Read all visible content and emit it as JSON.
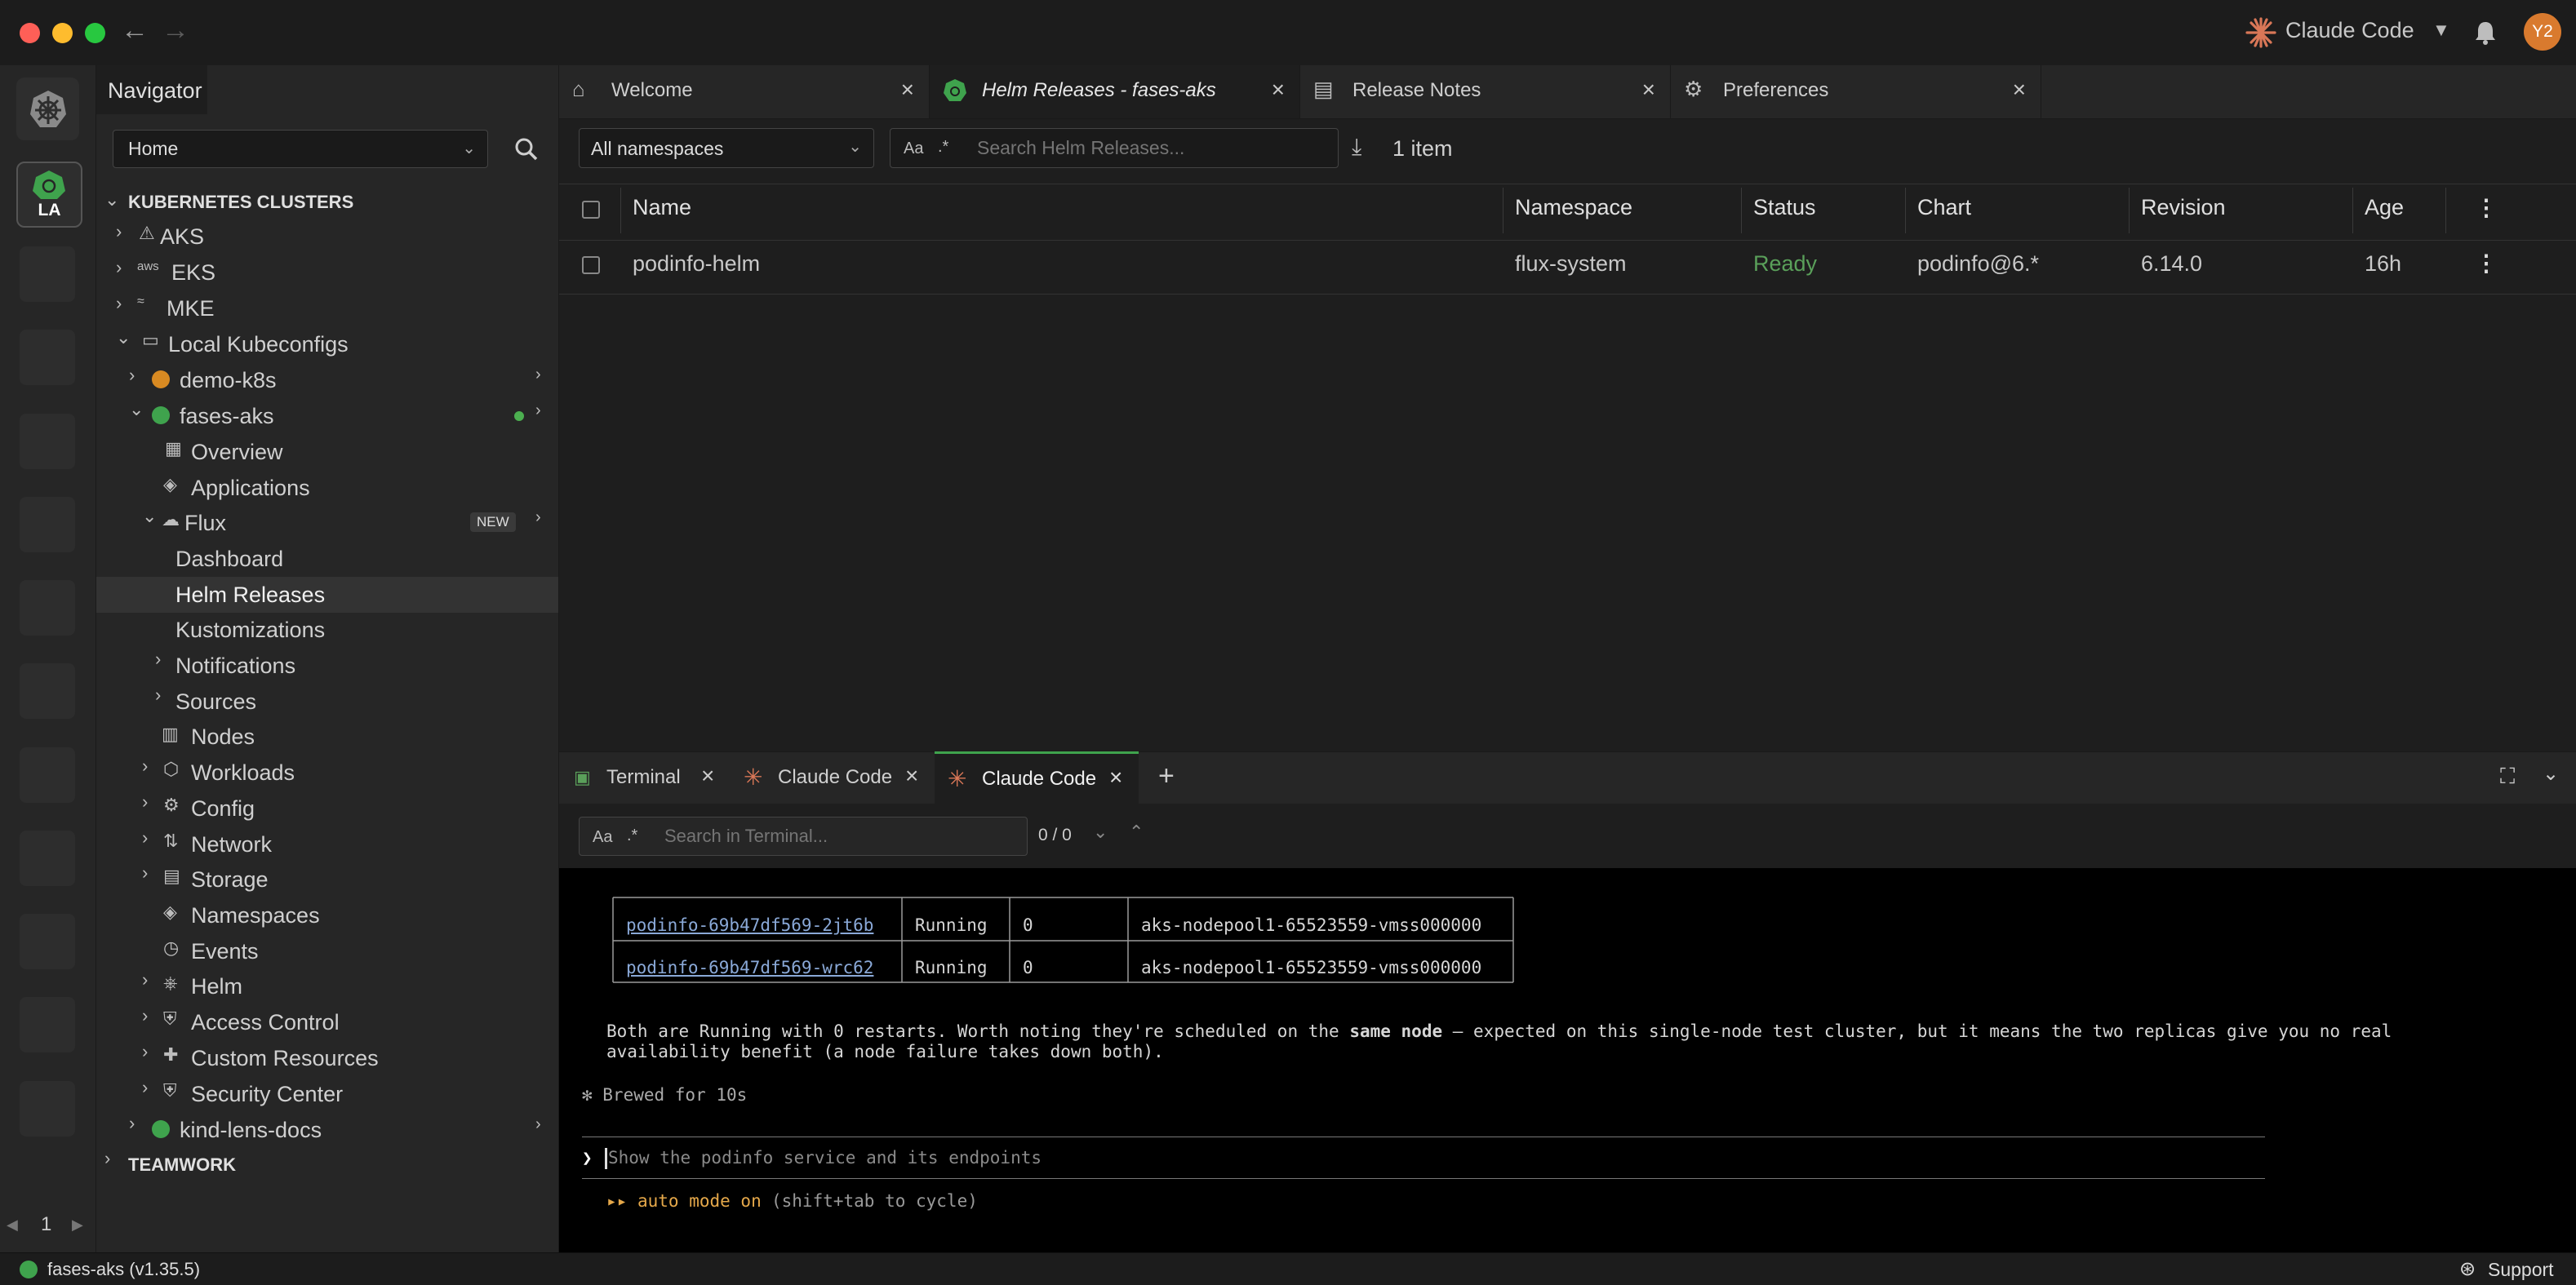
{
  "window": {
    "app_title": "Claude Code",
    "avatar_initials": "Y2"
  },
  "hotbar": {
    "cluster_badge": "LA"
  },
  "navigator": {
    "title": "Navigator",
    "workspace_select": "Home",
    "section_clusters": "KUBERNETES CLUSTERS",
    "providers": [
      "AKS",
      "EKS",
      "MKE"
    ],
    "eks_logo_text": "aws",
    "local_group": "Local Kubeconfigs",
    "clusters": {
      "demo": "demo-k8s",
      "fases": "fases-aks",
      "kind": "kind-lens-docs"
    },
    "items": {
      "overview": "Overview",
      "applications": "Applications",
      "flux": "Flux",
      "flux_badge": "NEW",
      "dashboard": "Dashboard",
      "helm_releases": "Helm Releases",
      "kustomizations": "Kustomizations",
      "notifications": "Notifications",
      "sources": "Sources",
      "nodes": "Nodes",
      "workloads": "Workloads",
      "config": "Config",
      "network": "Network",
      "storage": "Storage",
      "namespaces": "Namespaces",
      "events": "Events",
      "helm": "Helm",
      "access_control": "Access Control",
      "custom_resources": "Custom Resources",
      "security_center": "Security Center"
    },
    "section_teamwork": "TEAMWORK",
    "page_number": "1"
  },
  "tabs": [
    {
      "label": "Welcome"
    },
    {
      "label": "Helm Releases - fases-aks"
    },
    {
      "label": "Release Notes"
    },
    {
      "label": "Preferences"
    }
  ],
  "toolbar": {
    "namespace_select": "All namespaces",
    "case_toggle": "Aa",
    "regex_toggle": ".*",
    "search_placeholder": "Search Helm Releases...",
    "item_count": "1 item"
  },
  "table": {
    "headers": [
      "Name",
      "Namespace",
      "Status",
      "Chart",
      "Revision",
      "Age"
    ],
    "rows": [
      {
        "name": "podinfo-helm",
        "namespace": "flux-system",
        "status": "Ready",
        "chart": "podinfo@6.*",
        "revision": "6.14.0",
        "age": "16h"
      }
    ]
  },
  "colors": {
    "status_ready": "#5aa05a",
    "accent_orange": "#e5a84a",
    "claude_orange": "#d97757"
  },
  "dock": {
    "tabs": [
      "Terminal",
      "Claude Code",
      "Claude Code"
    ],
    "search_case": "Aa",
    "search_regex": ".*",
    "search_placeholder": "Search in Terminal...",
    "match_count": "0 / 0"
  },
  "terminal": {
    "pods": [
      {
        "name": "podinfo-69b47df569-2jt6b",
        "status": "Running",
        "restarts": "0",
        "node": "aks-nodepool1-65523559-vmss000000"
      },
      {
        "name": "podinfo-69b47df569-wrc62",
        "status": "Running",
        "restarts": "0",
        "node": "aks-nodepool1-65523559-vmss000000"
      }
    ],
    "message_before": "Both are Running with 0 restarts. Worth noting they're scheduled on the ",
    "message_bold": "same node",
    "message_after": " — expected on this single-node test cluster, but it means the two replicas give you no real",
    "message_line2": "availability benefit (a node failure takes down both).",
    "brewed": "✻ Brewed for 10s",
    "prompt_placeholder": "Show the podinfo service and its endpoints",
    "mode_marker": "▸▸",
    "mode_text": "auto mode on",
    "mode_hint": "(shift+tab to cycle)"
  },
  "statusbar": {
    "cluster": "fases-aks (v1.35.5)",
    "support": "Support"
  }
}
